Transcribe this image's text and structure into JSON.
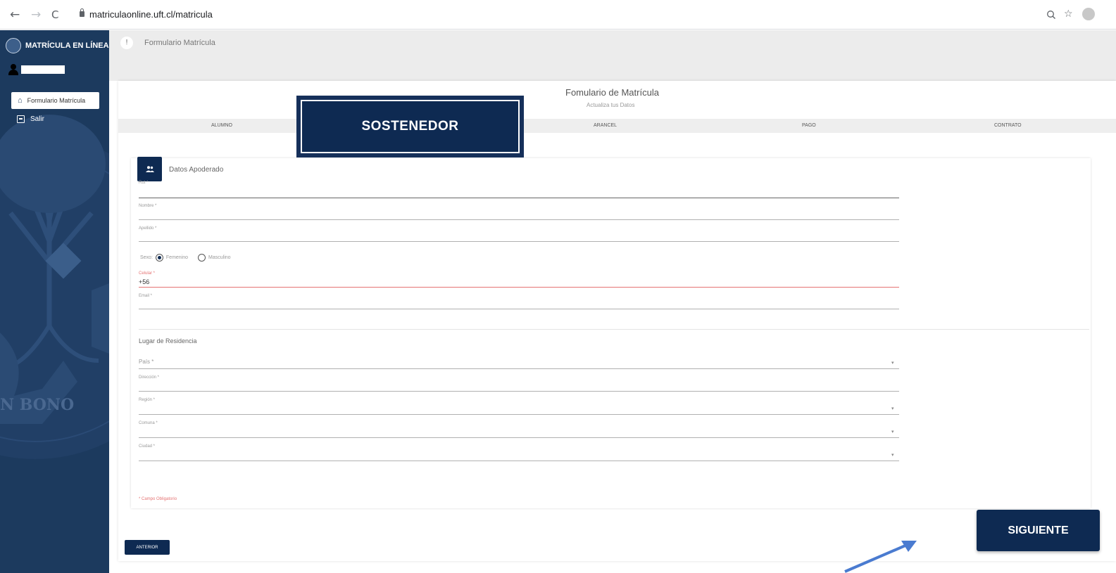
{
  "browser": {
    "back": "←",
    "forward": "→",
    "reload": "C",
    "url": "matriculaonline.uft.cl/matricula",
    "zoom_icon": "magnifier-icon",
    "star": "☆"
  },
  "sidebar": {
    "brand": "MATRÍCULA EN LÍNEA",
    "items": [
      {
        "label": "Formulario Matrícula",
        "icon": "home-icon"
      },
      {
        "label": "Salir",
        "icon": "exit-icon"
      }
    ],
    "watermark": "N BONO"
  },
  "topbar": {
    "info": "!",
    "title": "Formulario Matrícula"
  },
  "form": {
    "title": "Fomulario de Matrícula",
    "subtitle": "Actualiza tus Datos",
    "steps": [
      "ALUMNO",
      "ARANCEL",
      "PAGO",
      "CONTRATO"
    ]
  },
  "callout": {
    "label": "SOSTENEDOR"
  },
  "panel": {
    "title": "Datos Apoderado",
    "fields": {
      "rut": "Rut *",
      "nombre": "Nombre *",
      "apellido": "Apellido *",
      "celular": "Celular *",
      "celular_value": "+56",
      "email": "Email *"
    },
    "sexo": {
      "label": "Sexo:",
      "options": [
        "Femenino",
        "Masculino"
      ],
      "selected": "Femenino"
    },
    "residence_title": "Lugar de Residencia",
    "residence_fields": {
      "pais": "País *",
      "direccion": "Dirección *",
      "region": "Región *",
      "comuna": "Comuna *",
      "ciudad": "Ciudad *"
    },
    "required_note": "* Campo Obligatorio"
  },
  "buttons": {
    "prev": "ANTERIOR",
    "next": "SIGUIENTE"
  },
  "colors": {
    "sidebar": "#1c3a5e",
    "primary": "#0e2a52",
    "required": "#e57373",
    "arrow": "#4a7bd0"
  }
}
